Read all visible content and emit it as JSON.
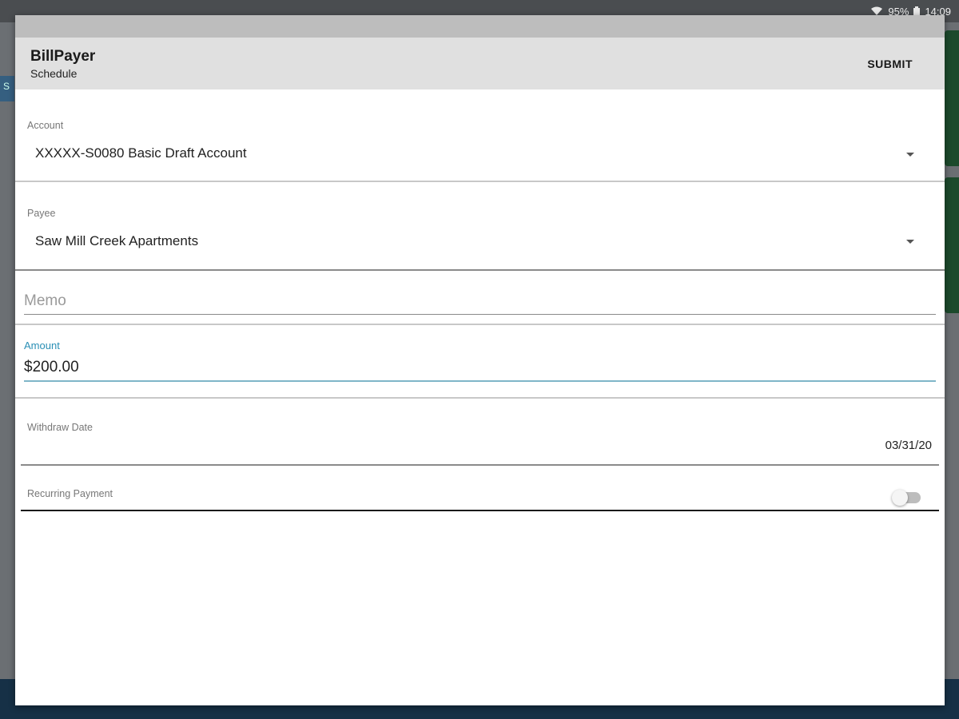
{
  "status_bar": {
    "battery": "95%",
    "time": "14:09"
  },
  "background": {
    "left_strip_text": "S"
  },
  "dialog": {
    "app_title": "BillPayer",
    "app_subtitle": "Schedule",
    "submit_label": "SUBMIT"
  },
  "form": {
    "account": {
      "label": "Account",
      "value": "XXXXX-S0080 Basic Draft Account"
    },
    "payee": {
      "label": "Payee",
      "value": "Saw Mill Creek Apartments"
    },
    "memo": {
      "placeholder": "Memo",
      "value": ""
    },
    "amount": {
      "label": "Amount",
      "value": "$200.00"
    },
    "withdraw_date": {
      "label": "Withdraw Date",
      "value": "03/31/20"
    },
    "recurring_payment": {
      "label": "Recurring Payment",
      "enabled": false
    }
  },
  "colors": {
    "accent": "#2a8fb5",
    "appbar": "#e0e0e0"
  }
}
